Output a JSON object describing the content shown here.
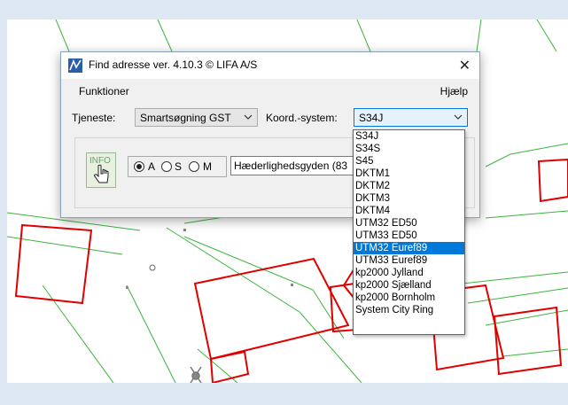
{
  "window": {
    "title": "Find adresse ver. 4.10.3 © LIFA A/S",
    "close_symbol": "✕"
  },
  "menu": {
    "left": "Funktioner",
    "right": "Hjælp"
  },
  "tjeneste": {
    "label": "Tjeneste:",
    "value": "Smartsøgning GST"
  },
  "koord": {
    "label": "Koord.-system:",
    "value": "S34J"
  },
  "info_button": {
    "label": "INFO"
  },
  "radio": {
    "a": "A",
    "s": "S",
    "m": "M",
    "selected": "A"
  },
  "address_field": {
    "value": "Hæderlighedsgyden (83"
  },
  "dropdown": {
    "options": [
      "S34J",
      "S34S",
      "S45",
      "DKTM1",
      "DKTM2",
      "DKTM3",
      "DKTM4",
      "UTM32 ED50",
      "UTM33 ED50",
      "UTM32 Euref89",
      "UTM33 Euref89",
      "kp2000 Jylland",
      "kp2000 Sjælland",
      "kp2000 Bornholm",
      "System City Ring"
    ],
    "selected_index": 9
  },
  "colors": {
    "accent": "#0078d7",
    "parcel_line": "#e00000",
    "road_line": "#2bb52b",
    "window_bg": "#f0f0f0"
  }
}
